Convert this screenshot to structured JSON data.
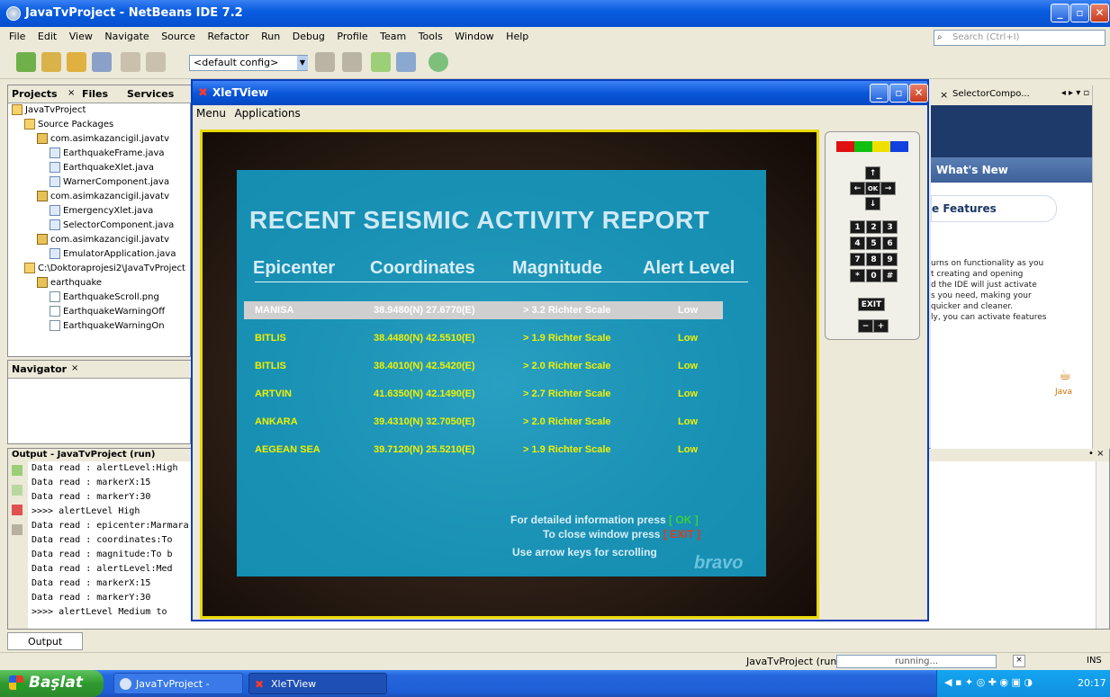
{
  "window": {
    "title": "JavaTvProject - NetBeans IDE 7.2"
  },
  "menu": [
    "File",
    "Edit",
    "View",
    "Navigate",
    "Source",
    "Refactor",
    "Run",
    "Debug",
    "Profile",
    "Team",
    "Tools",
    "Window",
    "Help"
  ],
  "search": {
    "placeholder": "Search (Ctrl+I)"
  },
  "toolbar": {
    "config": "<default config>"
  },
  "projects_panel": {
    "tabs": [
      "Projects",
      "Files",
      "Services"
    ],
    "tree": [
      {
        "label": "JavaTvProject",
        "indent": 0,
        "icon": "project"
      },
      {
        "label": "Source Packages",
        "indent": 1,
        "icon": "folder"
      },
      {
        "label": "com.asimkazancigil.javatv",
        "indent": 2,
        "icon": "package"
      },
      {
        "label": "EarthquakeFrame.java",
        "indent": 3,
        "icon": "java"
      },
      {
        "label": "EarthquakeXlet.java",
        "indent": 3,
        "icon": "java"
      },
      {
        "label": "WarnerComponent.java",
        "indent": 3,
        "icon": "java"
      },
      {
        "label": "com.asimkazancigil.javatv",
        "indent": 2,
        "icon": "package"
      },
      {
        "label": "EmergencyXlet.java",
        "indent": 3,
        "icon": "java"
      },
      {
        "label": "SelectorComponent.java",
        "indent": 3,
        "icon": "java"
      },
      {
        "label": "com.asimkazancigil.javatv",
        "indent": 2,
        "icon": "package"
      },
      {
        "label": "EmulatorApplication.java",
        "indent": 3,
        "icon": "java"
      },
      {
        "label": "C:\\Doktoraprojesi2\\JavaTvProject",
        "indent": 1,
        "icon": "folder"
      },
      {
        "label": "earthquake",
        "indent": 2,
        "icon": "package"
      },
      {
        "label": "EarthquakeScroll.png",
        "indent": 3,
        "icon": "file"
      },
      {
        "label": "EarthquakeWarningOff",
        "indent": 3,
        "icon": "file"
      },
      {
        "label": "EarthquakeWarningOn",
        "indent": 3,
        "icon": "file"
      }
    ]
  },
  "navigator": {
    "title": "Navigator"
  },
  "output": {
    "title": "Output - JavaTvProject (run)",
    "lines": [
      "Data read : alertLevel:High",
      "Data read : markerX:15",
      "Data read : markerY:30",
      ">>>> alertLevel High",
      "Data read : epicenter:Marmara",
      "Data read : coordinates:To",
      "Data read : magnitude:To b",
      "Data read : alertLevel:Med",
      "Data read : markerX:15",
      "Data read : markerY:30",
      ">>>> alertLevel Medium to"
    ],
    "tab": "Output"
  },
  "xlet": {
    "title": "XleTView",
    "menu": [
      "Menu",
      "Applications"
    ],
    "report_title": "RECENT SEISMIC ACTIVITY REPORT",
    "headers": [
      "Epicenter",
      "Coordinates",
      "Magnitude",
      "Alert Level"
    ],
    "rows": [
      {
        "epicenter": "MANISA",
        "coords": "38.9480(N) 27.6770(E)",
        "magnitude": "> 3.2 Richter Scale",
        "alert": "Low"
      },
      {
        "epicenter": "BITLIS",
        "coords": "38.4480(N) 42.5510(E)",
        "magnitude": "> 1.9 Richter Scale",
        "alert": "Low"
      },
      {
        "epicenter": "BITLIS",
        "coords": "38.4010(N) 42.5420(E)",
        "magnitude": "> 2.0 Richter Scale",
        "alert": "Low"
      },
      {
        "epicenter": "ARTVIN",
        "coords": "41.6350(N) 42.1490(E)",
        "magnitude": "> 2.7 Richter Scale",
        "alert": "Low"
      },
      {
        "epicenter": "ANKARA",
        "coords": "39.4310(N) 32.7050(E)",
        "magnitude": "> 2.0 Richter Scale",
        "alert": "Low"
      },
      {
        "epicenter": "AEGEAN SEA",
        "coords": "39.7120(N) 25.5210(E)",
        "magnitude": "> 1.9 Richter Scale",
        "alert": "Low"
      }
    ],
    "foot1_text": "For detailed information press",
    "foot1_key": "[ OK ]",
    "foot2_text": "To close window press",
    "foot2_key": "[ EXIT ]",
    "foot3": "Use arrow keys for scrolling",
    "channel_logo": "bravo"
  },
  "remote": {
    "color_keys": [
      "#e01010",
      "#10c010",
      "#f0e000",
      "#1040e0"
    ],
    "arrows": {
      "up": "↑",
      "left": "←",
      "ok": "OK",
      "right": "→",
      "down": "↓"
    },
    "digits": [
      "1",
      "2",
      "3",
      "4",
      "5",
      "6",
      "7",
      "8",
      "9",
      "*",
      "0",
      "#"
    ],
    "exit": "EXIT",
    "minus": "−",
    "plus": "+"
  },
  "right_panel": {
    "tab": "SelectorCompo...",
    "whats_new": "What's New",
    "features": "e Features",
    "lines": [
      "urns on functionality as you",
      "t creating and opening",
      "d the IDE will just activate",
      "s you need, making your",
      "quicker and cleaner.",
      "ly, you can activate features"
    ],
    "java": "Java"
  },
  "statusbar": {
    "project": "JavaTvProject (run)",
    "status": "running...",
    "ins": "INS"
  },
  "taskbar": {
    "start": "Başlat",
    "tasks": [
      "JavaTvProject - NetB...",
      "XleTView"
    ],
    "clock": "20:17"
  }
}
